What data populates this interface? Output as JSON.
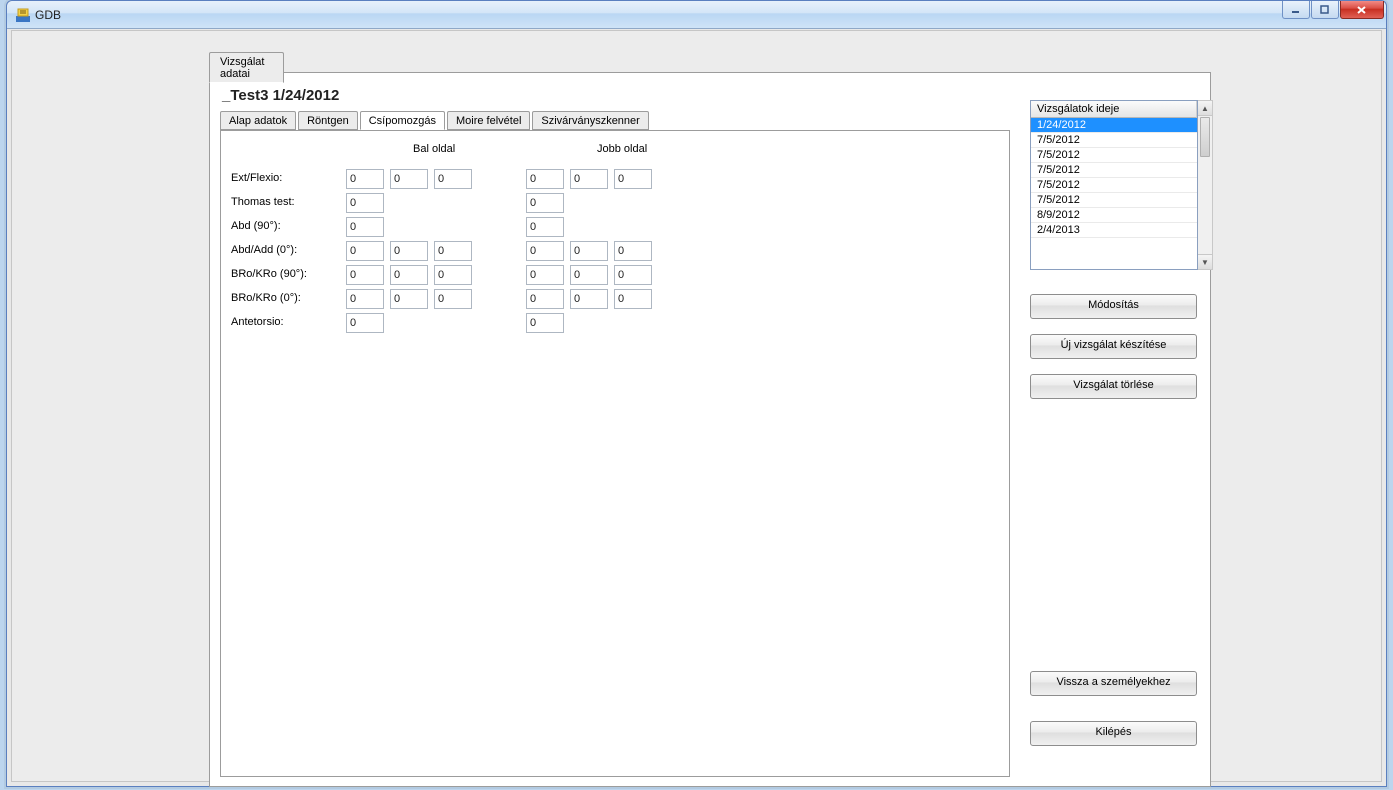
{
  "window": {
    "title": "GDB"
  },
  "outerTab": "Vizsgálat adatai",
  "pageTitle": "_Test3   1/24/2012",
  "tabs": [
    "Alap adatok",
    "Röntgen",
    "Csípomozgás",
    "Moire felvétel",
    "Szivárványszkenner"
  ],
  "activeTabIndex": 2,
  "colHeaders": {
    "left": "Bal oldal",
    "right": "Jobb oldal"
  },
  "rows": [
    {
      "label": "Ext/Flexio:",
      "left": [
        "0",
        "0",
        "0"
      ],
      "right": [
        "0",
        "0",
        "0"
      ]
    },
    {
      "label": "Thomas test:",
      "left": [
        "0"
      ],
      "right": [
        "0"
      ]
    },
    {
      "label": "Abd (90°):",
      "left": [
        "0"
      ],
      "right": [
        "0"
      ]
    },
    {
      "label": "Abd/Add (0°):",
      "left": [
        "0",
        "0",
        "0"
      ],
      "right": [
        "0",
        "0",
        "0"
      ]
    },
    {
      "label": "BRo/KRo (90°):",
      "left": [
        "0",
        "0",
        "0"
      ],
      "right": [
        "0",
        "0",
        "0"
      ]
    },
    {
      "label": "BRo/KRo (0°):",
      "left": [
        "0",
        "0",
        "0"
      ],
      "right": [
        "0",
        "0",
        "0"
      ]
    },
    {
      "label": "Antetorsio:",
      "left": [
        "0"
      ],
      "right": [
        "0"
      ]
    }
  ],
  "examList": {
    "header": "Vizsgálatok ideje",
    "items": [
      "1/24/2012",
      "7/5/2012",
      "7/5/2012",
      "7/5/2012",
      "7/5/2012",
      "7/5/2012",
      "8/9/2012",
      "2/4/2013"
    ],
    "selectedIndex": 0
  },
  "buttons": {
    "modify": "Módosítás",
    "newExam": "Új vizsgálat készítése",
    "deleteExam": "Vizsgálat törlése",
    "back": "Vissza a személyekhez",
    "exit": "Kilépés"
  }
}
